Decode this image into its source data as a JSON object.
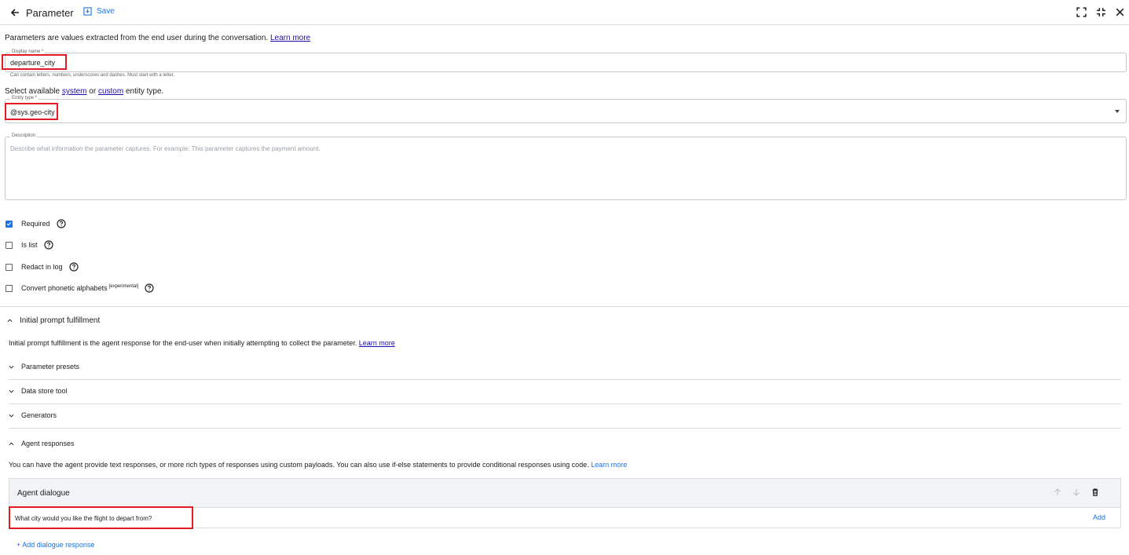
{
  "header": {
    "title": "Parameter",
    "save_label": "Save"
  },
  "intro": {
    "text": "Parameters are values extracted from the end user during the conversation. ",
    "link": "Learn more"
  },
  "display_name": {
    "label": "Display name *",
    "value": "departure_city",
    "hint": "Can contain letters, numbers, underscores and dashes. Must start with a letter."
  },
  "entity": {
    "select_prefix": "Select available ",
    "system_link": "system",
    "or_text": " or ",
    "custom_link": "custom",
    "suffix": " entity type.",
    "label": "Entity type *",
    "value": "@sys.geo-city"
  },
  "description": {
    "label": "Description",
    "placeholder": "Describe what information the parameter captures. For example: This parameter captures the payment amount."
  },
  "options": [
    {
      "label": "Required",
      "checked": true
    },
    {
      "label": "Is list",
      "checked": false
    },
    {
      "label": "Redact in log",
      "checked": false
    },
    {
      "label": "Convert phonetic alphabets",
      "sup": "[experimental]",
      "checked": false
    }
  ],
  "initial_prompt": {
    "title": "Initial prompt fulfillment",
    "desc": "Initial prompt fulfillment is the agent response for the end-user when initially attempting to collect the parameter. ",
    "link": "Learn more"
  },
  "subsections": {
    "presets": "Parameter presets",
    "datastore": "Data store tool",
    "generators": "Generators",
    "agent_responses": "Agent responses"
  },
  "agent_responses": {
    "desc": "You can have the agent provide text responses, or more rich types of responses using custom payloads. You can also use if-else statements to provide conditional responses using code. ",
    "link": "Learn more"
  },
  "agent_dialogue": {
    "title": "Agent dialogue",
    "text": "What city would you like the flight to depart from?",
    "add": "Add"
  },
  "add_dialogue": "+ Add dialogue response",
  "colors": {
    "accent": "#1a73e8",
    "highlight": "#e31b23"
  }
}
